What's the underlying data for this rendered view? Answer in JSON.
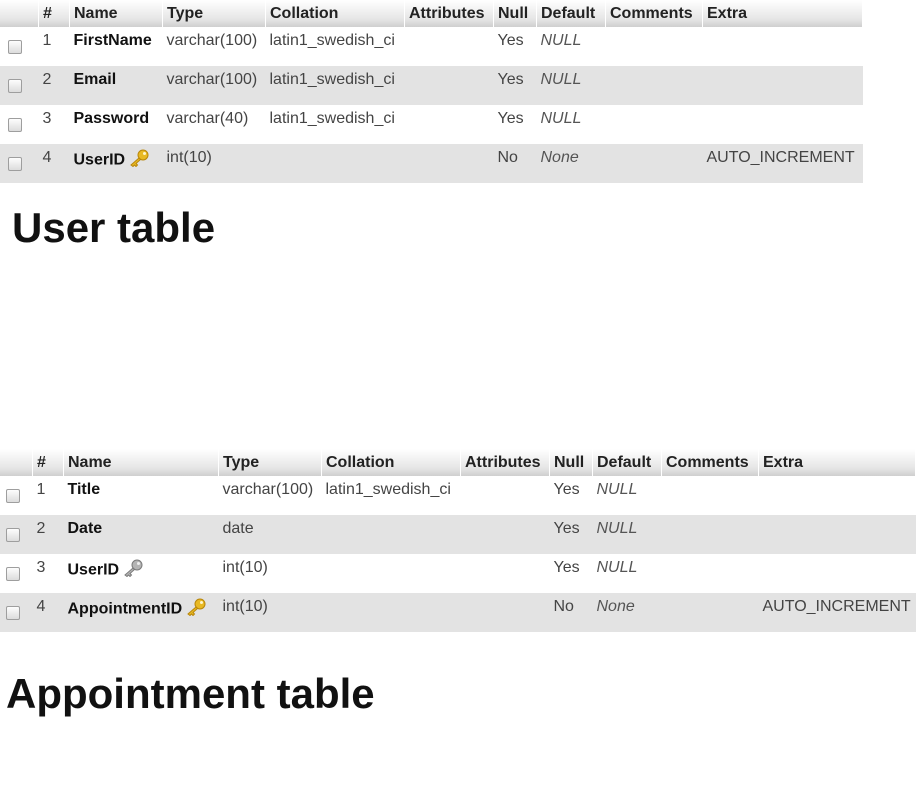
{
  "user_section": {
    "headers": [
      "#",
      "Name",
      "Type",
      "Collation",
      "Attributes",
      "Null",
      "Default",
      "Comments",
      "Extra"
    ],
    "rows": [
      {
        "num": "1",
        "name": "FirstName",
        "type": "varchar(100)",
        "collation": "latin1_swedish_ci",
        "attributes": "",
        "null": "Yes",
        "default": "NULL",
        "comments": "",
        "extra": "",
        "key": ""
      },
      {
        "num": "2",
        "name": "Email",
        "type": "varchar(100)",
        "collation": "latin1_swedish_ci",
        "attributes": "",
        "null": "Yes",
        "default": "NULL",
        "comments": "",
        "extra": "",
        "key": ""
      },
      {
        "num": "3",
        "name": "Password",
        "type": "varchar(40)",
        "collation": "latin1_swedish_ci",
        "attributes": "",
        "null": "Yes",
        "default": "NULL",
        "comments": "",
        "extra": "",
        "key": ""
      },
      {
        "num": "4",
        "name": "UserID",
        "type": "int(10)",
        "collation": "",
        "attributes": "",
        "null": "No",
        "default": "None",
        "comments": "",
        "extra": "AUTO_INCREMENT",
        "key": "primary-key-icon"
      }
    ],
    "caption": "User table"
  },
  "appointment_section": {
    "headers": [
      "#",
      "Name",
      "Type",
      "Collation",
      "Attributes",
      "Null",
      "Default",
      "Comments",
      "Extra"
    ],
    "rows": [
      {
        "num": "1",
        "name": "Title",
        "type": "varchar(100)",
        "collation": "latin1_swedish_ci",
        "attributes": "",
        "null": "Yes",
        "default": "NULL",
        "comments": "",
        "extra": "",
        "key": ""
      },
      {
        "num": "2",
        "name": "Date",
        "type": "date",
        "collation": "",
        "attributes": "",
        "null": "Yes",
        "default": "NULL",
        "comments": "",
        "extra": "",
        "key": ""
      },
      {
        "num": "3",
        "name": "UserID",
        "type": "int(10)",
        "collation": "",
        "attributes": "",
        "null": "Yes",
        "default": "NULL",
        "comments": "",
        "extra": "",
        "key": "index-key-icon"
      },
      {
        "num": "4",
        "name": "AppointmentID",
        "type": "int(10)",
        "collation": "",
        "attributes": "",
        "null": "No",
        "default": "None",
        "comments": "",
        "extra": "AUTO_INCREMENT",
        "key": "primary-key-icon"
      }
    ],
    "caption": "Appointment table"
  },
  "colors": {
    "header_bg": "#e6e6e6",
    "row_alt_bg": "#e3e3e3",
    "primary_key": "#e8b923",
    "index_key": "#a8a8a8"
  }
}
